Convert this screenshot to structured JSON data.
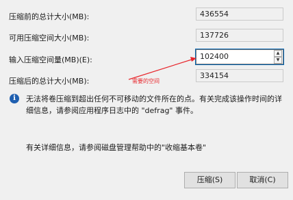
{
  "fields": [
    {
      "label": "压缩前的总计大小(MB):",
      "value": "436554"
    },
    {
      "label": "可用压缩空间大小(MB):",
      "value": "137726"
    },
    {
      "label": "输入压缩空间量(MB)(E):",
      "value": "102400"
    },
    {
      "label": "压缩后的总计大小(MB):",
      "value": "334154"
    }
  ],
  "annotation": "需要的空间",
  "annotation_color": "#e8262c",
  "info_message": "无法将卷压缩到超出任何不可移动的文件所在的点。有关完成该操作时间的详细信息，请参阅应用程序日志中的 \"defrag\" 事件。",
  "help_text": "有关详细信息，请参阅磁盘管理帮助中的\"收缩基本卷\"",
  "buttons": {
    "shrink": "压缩(S)",
    "cancel": "取消(C)"
  },
  "icons": {
    "info": "info-icon",
    "spin_up": "spin-up-icon",
    "spin_down": "spin-down-icon"
  }
}
